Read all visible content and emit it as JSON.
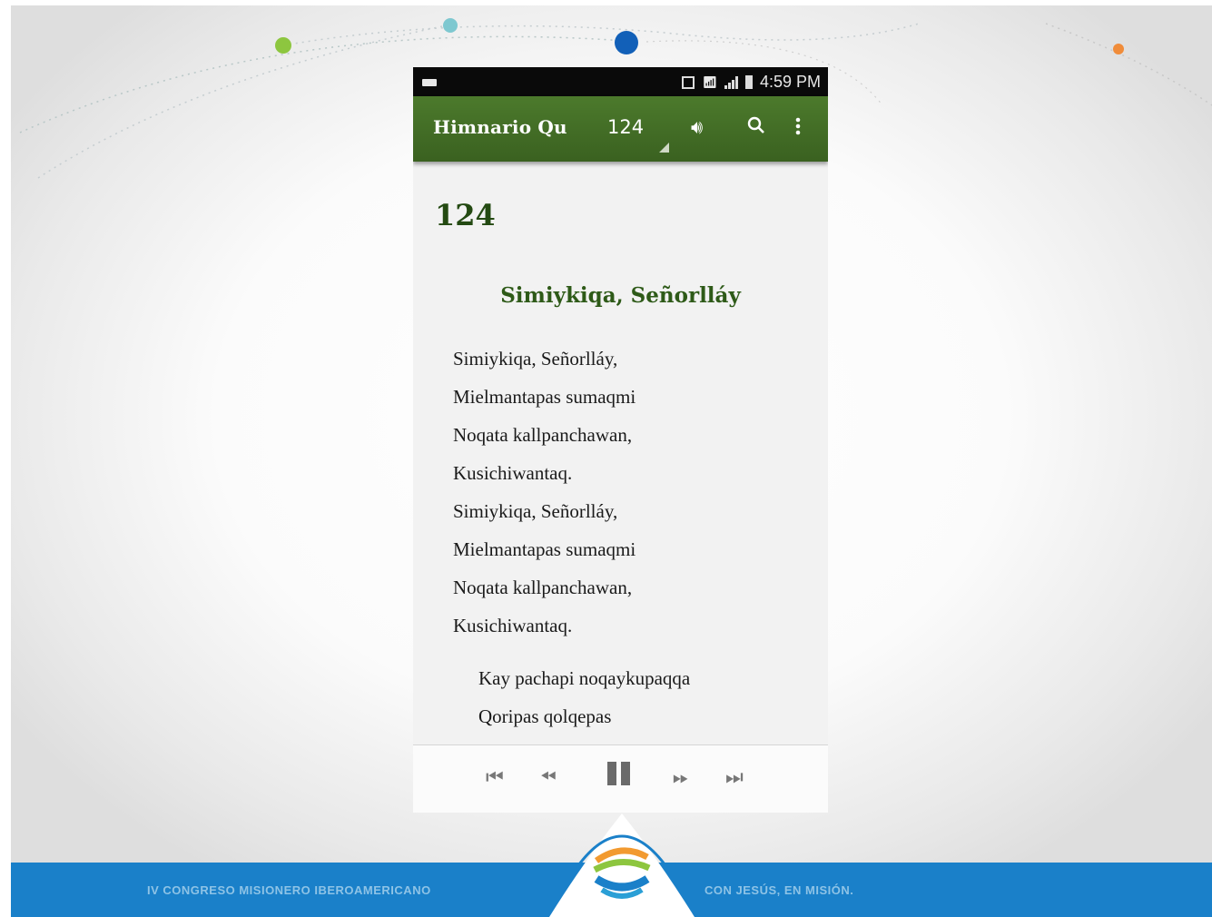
{
  "status_bar": {
    "time": "4:59 PM",
    "icons": [
      "battery-icon",
      "nfc-icon",
      "wifi-icon",
      "signal-icon",
      "battery-full-icon"
    ]
  },
  "toolbar": {
    "app_title": "Himnario Qu",
    "hymn_selector_value": "124",
    "icons": [
      "volume-icon",
      "search-icon",
      "overflow-menu-icon"
    ]
  },
  "hymn": {
    "number": "124",
    "title": "Simiykiqa, Señorlláy",
    "verse_lines": [
      "Simiykiqa, Señorlláy,",
      "Mielmantapas sumaqmi",
      "Noqata kallpanchawan,",
      "Kusichiwantaq.",
      "Simiykiqa, Señorlláy,",
      "Mielmantapas sumaqmi",
      "Noqata kallpanchawan,",
      "Kusichiwantaq."
    ],
    "verse2_lines": [
      "Kay pachapi noqaykupaqqa",
      "Qoripas qolqepas"
    ]
  },
  "player": {
    "buttons": [
      "skip-to-start-icon",
      "rewind-icon",
      "pause-icon",
      "fast-forward-icon",
      "skip-to-end-icon"
    ]
  },
  "footer": {
    "left_text": "IV CONGRESO MISIONERO IBEROAMERICANO",
    "right_text": "CON JESÚS, EN MISIÓN.",
    "brand_color": "#1a80c9"
  },
  "theme": {
    "toolbar_color": "#3e6624",
    "title_color": "#2e5a18"
  }
}
